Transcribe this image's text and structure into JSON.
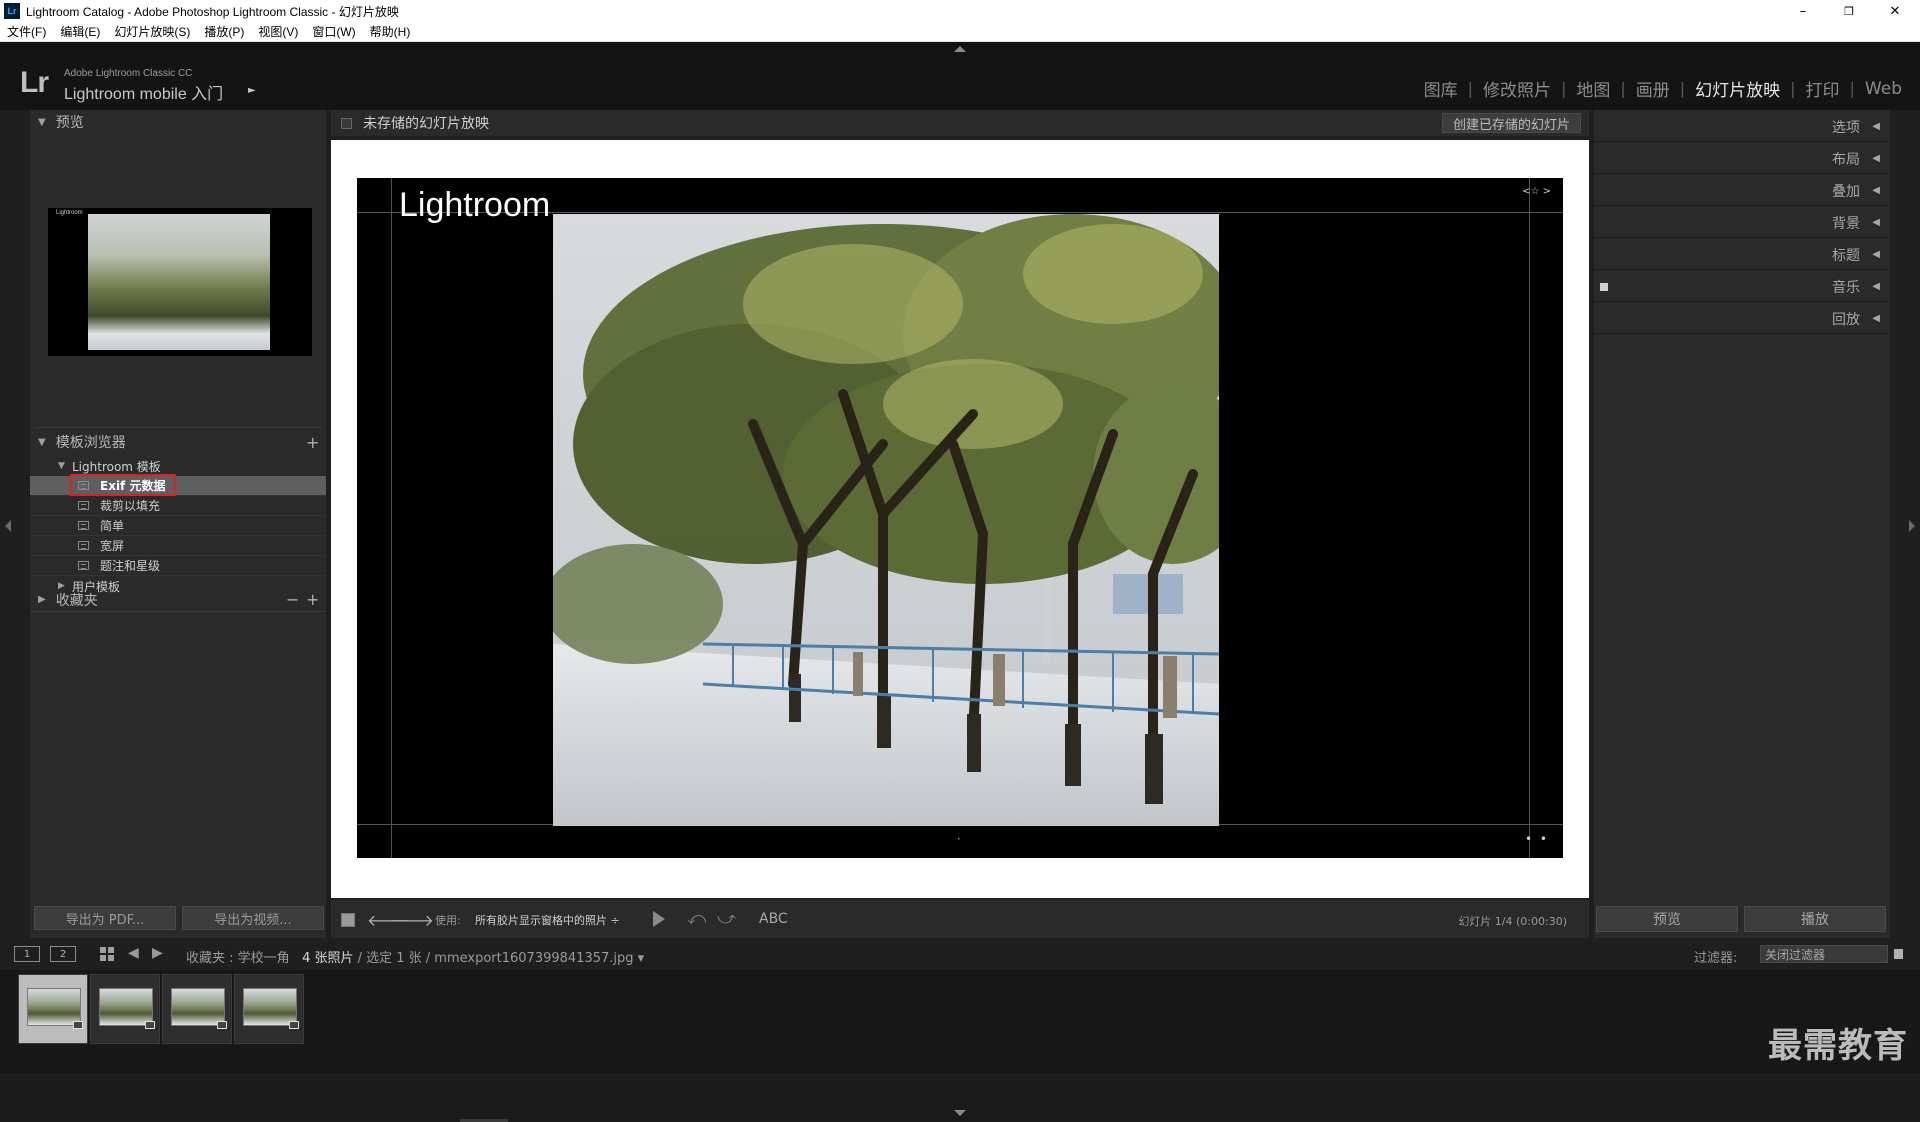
{
  "window": {
    "app_icon": "Lr",
    "title": "Lightroom Catalog - Adobe Photoshop Lightroom Classic - 幻灯片放映",
    "minimize": "–",
    "restore": "❐",
    "close": "✕"
  },
  "menu": [
    "文件(F)",
    "编辑(E)",
    "幻灯片放映(S)",
    "播放(P)",
    "视图(V)",
    "窗口(W)",
    "帮助(H)"
  ],
  "identity": {
    "logo": "Lr",
    "product": "Adobe Lightroom Classic CC",
    "mobile_label": "Lightroom mobile 入门",
    "mobile_arrow": "►"
  },
  "modules": [
    {
      "label": "图库",
      "active": false
    },
    {
      "label": "修改照片",
      "active": false
    },
    {
      "label": "地图",
      "active": false
    },
    {
      "label": "画册",
      "active": false
    },
    {
      "label": "幻灯片放映",
      "active": true
    },
    {
      "label": "打印",
      "active": false
    },
    {
      "label": "Web",
      "active": false
    }
  ],
  "left_panel": {
    "preview_header": "预览",
    "preview_slide_title": "Lightroom",
    "template_header": "模板浏览器",
    "template_add": "+",
    "folder_lightroom": "Lightroom 模板",
    "templates": [
      {
        "label": "Exif 元数据",
        "selected": true
      },
      {
        "label": "裁剪以填充",
        "selected": false
      },
      {
        "label": "简单",
        "selected": false
      },
      {
        "label": "宽屏",
        "selected": false
      },
      {
        "label": "题注和星级",
        "selected": false
      }
    ],
    "folder_user": "用户模板",
    "collections_header": "收藏夹",
    "collections_minus": "−",
    "collections_plus": "+",
    "export_pdf": "导出为 PDF...",
    "export_video": "导出为视频..."
  },
  "center": {
    "header_title": "未存储的幻灯片放映",
    "create_button": "创建已存储的幻灯片",
    "slide_title": "Lightroom",
    "slide_rating": "<☆ >",
    "slide_dots": "• •",
    "slide_center_dot": "•"
  },
  "toolbar": {
    "prev_icon": "🡐",
    "next_icon": "🡒",
    "use_label": "使用:",
    "source": "所有胶片显示窗格中的照片 ÷",
    "rotate_left": "⤺",
    "rotate_right": "⤻",
    "abc": "ABC",
    "slide_count": "幻灯片 1/4 (0:00:30)"
  },
  "right_panel": {
    "sections": [
      "选项",
      "布局",
      "叠加",
      "背景",
      "标题",
      "音乐",
      "回放"
    ],
    "preview_button": "预览",
    "play_button": "播放"
  },
  "filmbar": {
    "monitor1": "1",
    "monitor2": "2",
    "prev": "◀",
    "next": "▶",
    "collection": "收藏夹 : 学校一角",
    "count": "4 张照片",
    "selection": " / 选定 1 张 / mmexport1607399841357.jpg ▾",
    "filter_label": "过滤器:",
    "filter_value": "关闭过滤器"
  },
  "filmstrip": {
    "thumbnails": 4,
    "active_index": 0
  },
  "watermark": "最需教育"
}
